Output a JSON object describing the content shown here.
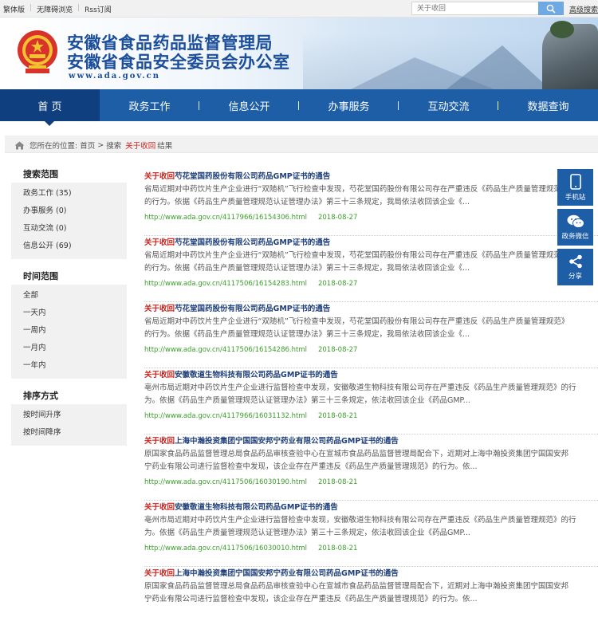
{
  "topbar": {
    "links": [
      "繁体版",
      "无障碍浏览",
      "Rss订阅"
    ],
    "search_placeholder": "关于收回",
    "advanced_search": "高级搜索"
  },
  "header": {
    "title_line1": "安徽省食品药品监督管理局",
    "title_line2": "安徽省食品安全委员会办公室",
    "site_url": "www.ada.gov.cn"
  },
  "nav": {
    "items": [
      "首 页",
      "政务工作",
      "信息公开",
      "办事服务",
      "互动交流",
      "数据查询"
    ]
  },
  "breadcrumb": {
    "prefix": "您所在的位置:",
    "home": "首页",
    "sep": ">",
    "search": "搜索",
    "keyword": "关于收回",
    "suffix": "结果"
  },
  "sidebar": {
    "scope_title": "搜索范围",
    "scope_items": [
      "政务工作 (35)",
      "办事服务 (0)",
      "互动交流 (0)",
      "信息公开 (69)"
    ],
    "time_title": "时间范围",
    "time_items": [
      "全部",
      "一天内",
      "一周内",
      "一月内",
      "一年内"
    ],
    "sort_title": "排序方式",
    "sort_items": [
      "按时间升序",
      "按时间降序"
    ]
  },
  "results": [
    {
      "kw": "关于收回",
      "title": "芍花堂国药股份有限公司药品GMP证书的通告",
      "line1": "省局近期对中药饮片生产企业进行“双随机”飞行检查中发现，芍花堂国药股份有限公司存在严重违反《药品生产质量管理规范》",
      "line2": "的行为。依据《药品生产质量管理规范认证管理办法》第三十三条规定，我局依法收回该企业《...",
      "url": "http://www.ada.gov.cn/4117966/16154306.html",
      "date": "2018-08-27"
    },
    {
      "kw": "关于收回",
      "title": "芍花堂国药股份有限公司药品GMP证书的通告",
      "line1": "省局近期对中药饮片生产企业进行“双随机”飞行检查中发现，芍花堂国药股份有限公司存在严重违反《药品生产质量管理规范》",
      "line2": "的行为。依据《药品生产质量管理规范认证管理办法》第三十三条规定，我局依法收回该企业《...",
      "url": "http://www.ada.gov.cn/4117506/16154283.html",
      "date": "2018-08-27"
    },
    {
      "kw": "关于收回",
      "title": "芍花堂国药股份有限公司药品GMP证书的通告",
      "line1": "省局近期对中药饮片生产企业进行“双随机”飞行检查中发现，芍花堂国药股份有限公司存在严重违反《药品生产质量管理规范》",
      "line2": "的行为。依据《药品生产质量管理规范认证管理办法》第三十三条规定，我局依法收回该企业《...",
      "url": "http://www.ada.gov.cn/4117506/16154286.html",
      "date": "2018-08-27"
    },
    {
      "kw": "关于收回",
      "title": "安徽敬道生物科技有限公司药品GMP证书的通告",
      "line1": "亳州市局近期对中药饮片生产企业进行监督检查中发现，安徽敬道生物科技有限公司存在严重违反《药品生产质量管理规范》的行",
      "line2": "为。依据《药品生产质量管理规范认证管理办法》第三十三条规定，依法收回该企业《药品GMP...",
      "url": "http://www.ada.gov.cn/4117966/16031132.html",
      "date": "2018-08-21"
    },
    {
      "kw": "关于收回",
      "title": "上海中瀚投资集团宁国国安邦宁药业有限公司药品GMP证书的通告",
      "line1": "原国家食品药品监督管理总局食品药品审核查验中心在宣城市食品药品监督管理局配合下，近期对上海中瀚投资集团宁国国安邦",
      "line2": "宁药业有限公司进行监督检查中发现，该企业存在严重违反《药品生产质量管理规范》的行为。依...",
      "url": "http://www.ada.gov.cn/4117506/16030190.html",
      "date": "2018-08-21"
    },
    {
      "kw": "关于收回",
      "title": "安徽敬道生物科技有限公司药品GMP证书的通告",
      "line1": "亳州市局近期对中药饮片生产企业进行监督检查中发现，安徽敬道生物科技有限公司存在严重违反《药品生产质量管理规范》的行",
      "line2": "为。依据《药品生产质量管理规范认证管理办法》第三十三条规定，依法收回该企业《药品GMP...",
      "url": "http://www.ada.gov.cn/4117506/16030010.html",
      "date": "2018-08-21"
    },
    {
      "kw": "关于收回",
      "title": "上海中瀚投资集团宁国国安邦宁药业有限公司药品GMP证书的通告",
      "line1": "原国家食品药品监督管理总局食品药品审核查验中心在宣城市食品药品监督管理局配合下，近期对上海中瀚投资集团宁国国安邦",
      "line2": "宁药业有限公司进行监督检查中发现，该企业存在严重违反《药品生产质量管理规范》的行为。依...",
      "url": "",
      "date": ""
    }
  ],
  "float_tools": [
    "手机站",
    "政务微信",
    "分享"
  ]
}
